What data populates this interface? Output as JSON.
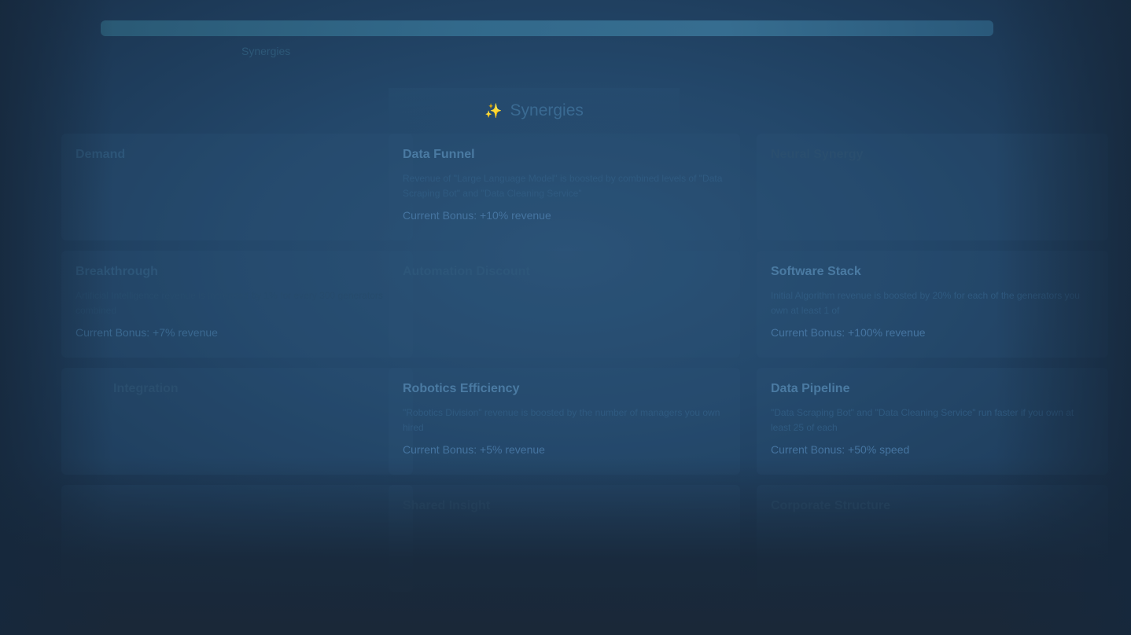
{
  "header": {
    "subtitle": "Synergies"
  },
  "section": {
    "icon": "✨",
    "title": "Synergies"
  },
  "cards": [
    {
      "title": "Demand",
      "description": "",
      "bonus": ""
    },
    {
      "title": "Data Funnel",
      "description": "Revenue of \"Large Language Model\" is boosted by combined levels of \"Data Scraping Bot\" and \"Data Cleaning Service\"",
      "bonus": "Current Bonus: +10% revenue"
    },
    {
      "title": "Neural Synergy",
      "description": "",
      "bonus": ""
    },
    {
      "title": "Breakthrough",
      "description": "Artificial Intelligence revenue is increased by 1% for every 300 generators combined",
      "bonus": "Current Bonus: +7% revenue"
    },
    {
      "title": "Automation Discount",
      "description": "",
      "bonus": ""
    },
    {
      "title": "Software Stack",
      "description": "Initial Algorithm revenue is boosted by 20% for each of the generators you own at least 1 of",
      "bonus": "Current Bonus: +100% revenue"
    },
    {
      "title": "Integration",
      "description": "",
      "bonus": ""
    },
    {
      "title": "Robotics Efficiency",
      "description": "\"Robotics Division\" revenue is boosted by the number of managers you own hired",
      "bonus": "Current Bonus: +5% revenue"
    },
    {
      "title": "Data Pipeline",
      "description": "\"Data Scraping Bot\" and \"Data Cleaning Service\" run faster if you own at least 25 of each",
      "bonus": "Current Bonus: +50% speed"
    },
    {
      "title": "",
      "description": "",
      "bonus": ""
    },
    {
      "title": "Shared Insight",
      "description": "",
      "bonus": ""
    },
    {
      "title": "Corporate Structure",
      "description": "",
      "bonus": ""
    }
  ]
}
